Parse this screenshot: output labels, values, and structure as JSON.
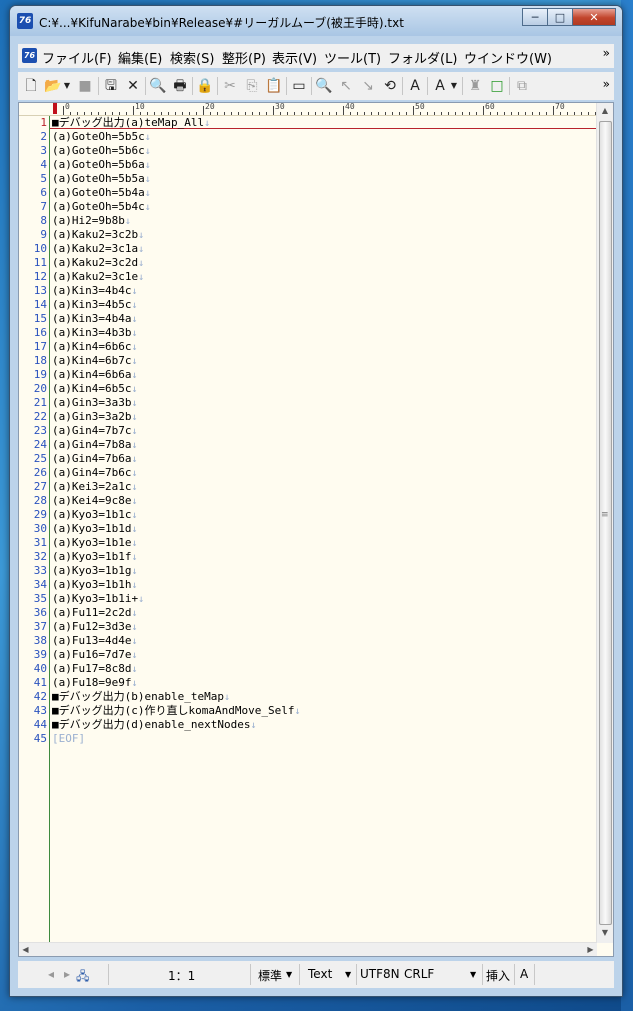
{
  "window": {
    "title": "C:¥...¥KifuNarabe¥bin¥Release¥#リーガルムーブ(被王手時).txt",
    "app_icon_text": "76",
    "minimize": "─",
    "maximize": "□",
    "close": "✕"
  },
  "menu": {
    "items": [
      "ファイル(F)",
      "編集(E)",
      "検索(S)",
      "整形(P)",
      "表示(V)",
      "ツール(T)",
      "フォルダ(L)",
      "ウインドウ(W)"
    ],
    "overflow": "»"
  },
  "toolbar": {
    "icons": [
      "new-file-icon",
      "open-file-icon",
      "dropdown-icon",
      "save-disabled-icon",
      "save-all-icon",
      "close-file-icon",
      "print-preview-icon",
      "print-icon",
      "lock-icon",
      "cut-icon",
      "copy-icon",
      "paste-icon",
      "ruler-icon",
      "search-icon",
      "find-prev-icon",
      "find-next-icon",
      "replace-icon",
      "font-color-icon",
      "spell-check-icon",
      "dropdown-icon",
      "plugin-icon",
      "outline-icon",
      "window-icon"
    ],
    "overflow": "»"
  },
  "editor": {
    "ruler_labels": [
      "0",
      "10",
      "20",
      "30",
      "40",
      "50",
      "60",
      "70"
    ],
    "eol_mark": "↓",
    "lines": [
      "■デバッグ出力(a)teMap_All",
      "(a)GoteOh=5b5c",
      "(a)GoteOh=5b6c",
      "(a)GoteOh=5b6a",
      "(a)GoteOh=5b5a",
      "(a)GoteOh=5b4a",
      "(a)GoteOh=5b4c",
      "(a)Hi2=9b8b",
      "(a)Kaku2=3c2b",
      "(a)Kaku2=3c1a",
      "(a)Kaku2=3c2d",
      "(a)Kaku2=3c1e",
      "(a)Kin3=4b4c",
      "(a)Kin3=4b5c",
      "(a)Kin3=4b4a",
      "(a)Kin3=4b3b",
      "(a)Kin4=6b6c",
      "(a)Kin4=6b7c",
      "(a)Kin4=6b6a",
      "(a)Kin4=6b5c",
      "(a)Gin3=3a3b",
      "(a)Gin3=3a2b",
      "(a)Gin4=7b7c",
      "(a)Gin4=7b8a",
      "(a)Gin4=7b6a",
      "(a)Gin4=7b6c",
      "(a)Kei3=2a1c",
      "(a)Kei4=9c8e",
      "(a)Kyo3=1b1c",
      "(a)Kyo3=1b1d",
      "(a)Kyo3=1b1e",
      "(a)Kyo3=1b1f",
      "(a)Kyo3=1b1g",
      "(a)Kyo3=1b1h",
      "(a)Kyo3=1b1i+",
      "(a)Fu11=2c2d",
      "(a)Fu12=3d3e",
      "(a)Fu13=4d4e",
      "(a)Fu16=7d7e",
      "(a)Fu17=8c8d",
      "(a)Fu18=9e9f",
      "■デバッグ出力(b)enable_teMap",
      "■デバッグ出力(c)作り直しkomaAndMove_Self",
      "■デバッグ出力(d)enable_nextNodes"
    ],
    "eof": "[EOF]"
  },
  "status": {
    "position": "1：1",
    "input_mode": "標準",
    "file_type": "Text",
    "encoding": "UTF8N",
    "line_ending": "CRLF",
    "insert_mode": "挿入",
    "ime": "A"
  }
}
